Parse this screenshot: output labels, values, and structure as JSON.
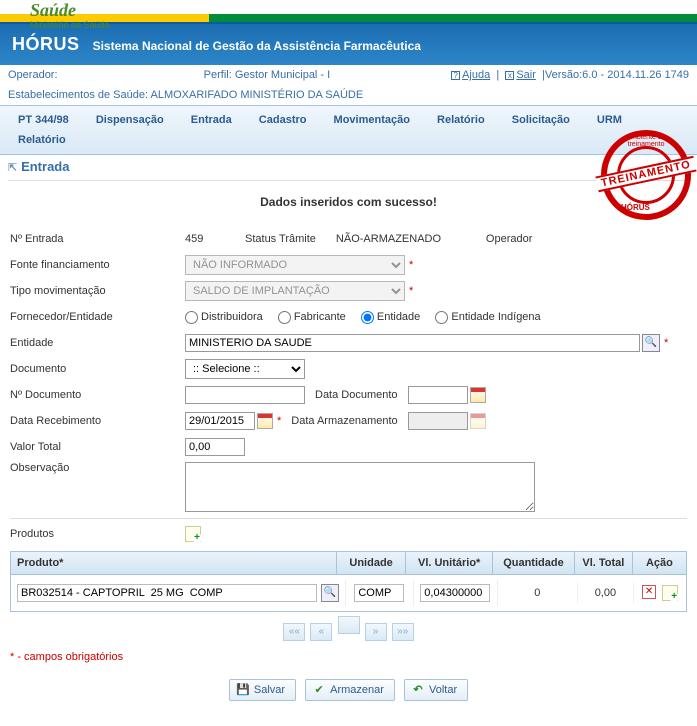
{
  "brand": {
    "name": "Saúde",
    "sub": "Ministério da Saúde"
  },
  "header": {
    "app": "HÓRUS",
    "tagline": "Sistema Nacional de Gestão da Assistência Farmacêutica"
  },
  "info": {
    "operador_label": "Operador:",
    "perfil_label": "Perfil:",
    "perfil_value": "Gestor Municipal - I",
    "ajuda": "Ajuda",
    "sair": "Sair",
    "versao": "Versão:6.0 - 2014.11.26 1749",
    "estab_label": "Estabelecimentos de Saúde:",
    "estab_value": "ALMOXARIFADO MINISTÉRIO DA SAÚDE"
  },
  "menu": [
    "PT 344/98",
    "Dispensação",
    "Entrada",
    "Cadastro",
    "Movimentação",
    "Relatório",
    "Solicitação",
    "URM",
    "Relatório"
  ],
  "page": {
    "title": "Entrada"
  },
  "success": "Dados inseridos com sucesso!",
  "stamp": {
    "arc": "Ambiente de treinamento",
    "main": "TREINAMENTO",
    "bottom": "HÓRUS"
  },
  "labels": {
    "n_entrada": "Nº Entrada",
    "status": "Status Trâmite",
    "operador": "Operador",
    "fonte": "Fonte financiamento",
    "tipo_mov": "Tipo movimentação",
    "fornecedor": "Fornecedor/Entidade",
    "entidade": "Entidade",
    "documento": "Documento",
    "n_doc": "Nº Documento",
    "data_doc": "Data Documento",
    "data_receb": "Data Recebimento",
    "data_armaz": "Data Armazenamento",
    "valor_total": "Valor Total",
    "obs": "Observação",
    "produtos": "Produtos"
  },
  "values": {
    "n_entrada": "459",
    "status": "NÃO-ARMAZENADO",
    "operador": "",
    "fonte": "NÃO INFORMADO",
    "tipo_mov": "SALDO DE IMPLANTAÇÃO",
    "entidade": "MINISTERIO DA SAUDE",
    "documento": ":: Selecione ::",
    "n_doc": "",
    "data_doc": "",
    "data_receb": "29/01/2015",
    "data_armaz": "",
    "valor_total": "0,00",
    "obs": ""
  },
  "radios": {
    "distribuidora": "Distribuidora",
    "fabricante": "Fabricante",
    "entidade": "Entidade",
    "entidade_ind": "Entidade Indígena"
  },
  "grid": {
    "headers": {
      "produto": "Produto*",
      "unidade": "Unidade",
      "vl_unit": "Vl. Unitário*",
      "qtd": "Quantidade",
      "vl_total": "Vl. Total",
      "acao": "Ação"
    },
    "row": {
      "produto": "BR032514 - CAPTOPRIL  25 MG  COMP",
      "unidade": "COMP",
      "vl_unit": "0,04300000",
      "qtd": "0",
      "vl_total": "0,00"
    }
  },
  "pager": [
    "««",
    "«",
    "",
    "»",
    "»»"
  ],
  "req_note": "* - campos obrigatórios",
  "buttons": {
    "salvar": "Salvar",
    "armazenar": "Armazenar",
    "voltar": "Voltar"
  }
}
